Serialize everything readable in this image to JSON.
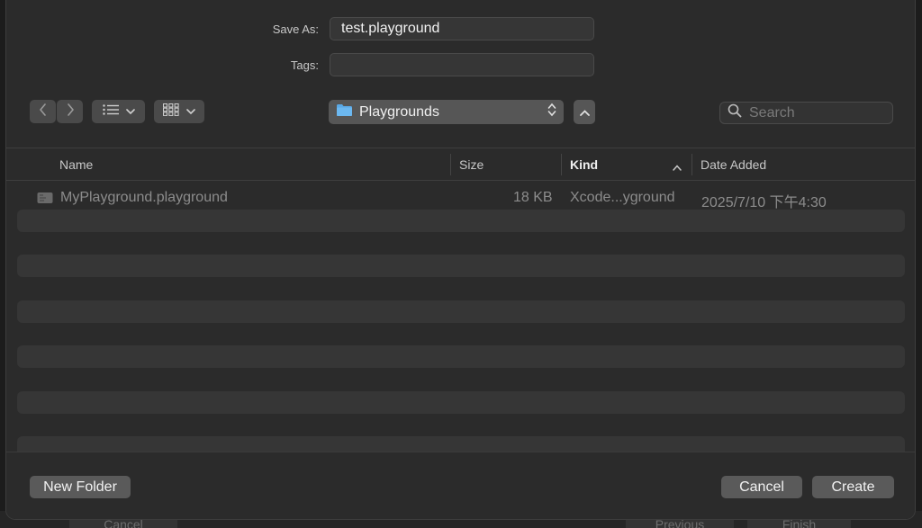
{
  "background": {
    "cancel_label": "Cancel",
    "previous_label": "Previous",
    "finish_label": "Finish"
  },
  "form": {
    "save_as_label": "Save As:",
    "save_as_value": "test.playground",
    "tags_label": "Tags:",
    "tags_value": ""
  },
  "toolbar": {
    "location": "Playgrounds",
    "search_placeholder": "Search"
  },
  "columns": {
    "name": "Name",
    "size": "Size",
    "kind": "Kind",
    "date_added": "Date Added",
    "sorted_by": "kind"
  },
  "files": [
    {
      "name": "MyPlayground.playground",
      "size": "18 KB",
      "kind": "Xcode...yground",
      "date_added": "2025/7/10 下午4:30"
    }
  ],
  "footer": {
    "new_folder_label": "New Folder",
    "cancel_label": "Cancel",
    "create_label": "Create"
  },
  "colors": {
    "sheet_bg": "#2b2b2b",
    "folder_icon": "#5aa9e6"
  }
}
